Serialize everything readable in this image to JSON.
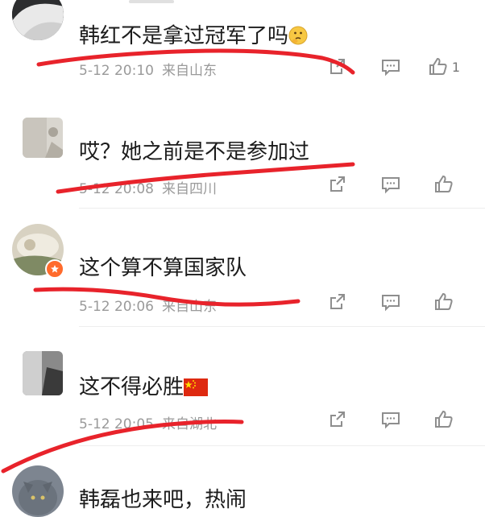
{
  "comments": [
    {
      "username": "",
      "text": "韩红不是拿过冠军了吗",
      "emoji": "thinking-face-emoji",
      "date": "5-12 20:10",
      "location": "来自山东",
      "like_count": "1"
    },
    {
      "username": "",
      "text": "哎？她之前是不是参加过",
      "date": "5-12 20:08",
      "location": "来自四川",
      "like_count": ""
    },
    {
      "username": "",
      "text": "这个算不算国家队",
      "date": "5-12 20:06",
      "location": "来自山东",
      "like_count": ""
    },
    {
      "username": "",
      "text": "这不得必胜",
      "emoji": "china-flag-emoji",
      "date": "5-12 20:05",
      "location": "来自湖北",
      "like_count": ""
    },
    {
      "username": "",
      "text": "韩磊也来吧，热闹",
      "date": "",
      "location": "",
      "like_count": ""
    }
  ],
  "colors": {
    "underline": "#e8232b",
    "icon": "#8e8e8e",
    "meta_text": "#9a9a9a",
    "badge": "#ff6b2c"
  },
  "icons": [
    "share-icon",
    "comment-icon",
    "like-icon"
  ]
}
